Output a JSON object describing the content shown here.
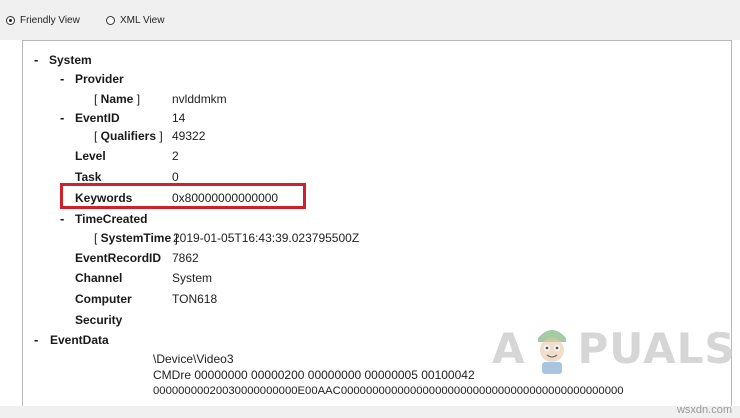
{
  "view_options": {
    "friendly_label": "Friendly View",
    "xml_label": "XML View",
    "selected": "Friendly View"
  },
  "tree": {
    "collapse_glyph": "-",
    "system_label": "System",
    "provider_label": "Provider",
    "name_label": "Name",
    "name_value": "nvlddmkm",
    "eventid_label": "EventID",
    "eventid_value": "14",
    "qualifiers_label": "Qualifiers",
    "qualifiers_value": "49322",
    "level_label": "Level",
    "level_value": "2",
    "task_label": "Task",
    "task_value": "0",
    "keywords_label": "Keywords",
    "keywords_value": "0x80000000000000",
    "timecreated_label": "TimeCreated",
    "systemtime_label": "SystemTime",
    "systemtime_value": "2019-01-05T16:43:39.023795500Z",
    "eventrecordid_label": "EventRecordID",
    "eventrecordid_value": "7862",
    "channel_label": "Channel",
    "channel_value": "System",
    "computer_label": "Computer",
    "computer_value": "TON618",
    "security_label": "Security",
    "eventdata_label": "EventData",
    "eventdata_line1": "\\Device\\Video3",
    "eventdata_line2": "CMDre 00000000 00000200 00000000 00000005 00100042",
    "eventdata_line3": "00000000020030000000000E00AAC000000000000000000000000000000000000000000000"
  },
  "branding": {
    "logo_text_left": "A",
    "logo_text_right": "PUALS",
    "watermark": "wsxdn.com"
  },
  "colors": {
    "highlight_box": "#cf2127",
    "toolbar_bg": "#f0f0f0"
  }
}
